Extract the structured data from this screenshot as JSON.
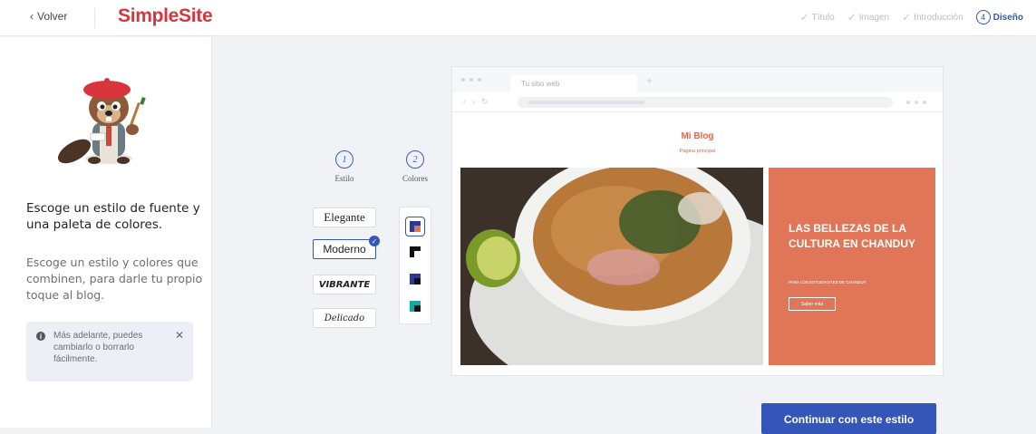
{
  "header": {
    "back_label": "Volver",
    "logo": "SimpleSite",
    "steps": [
      {
        "label": "Título",
        "state": "done"
      },
      {
        "label": "Imagen",
        "state": "done"
      },
      {
        "label": "Introducción",
        "state": "done"
      },
      {
        "label": "Diseño",
        "state": "active",
        "number": "4"
      }
    ]
  },
  "left": {
    "mascot_icon": "beaver-painter-icon",
    "heading": "Escoge un estilo de fuente y una paleta de colores.",
    "description": "Escoge un estilo y colores que combinen, para darle tu propio toque al blog.",
    "note": "Más adelante, puedes cambiarlo o borrarlo fácilmente."
  },
  "options": {
    "style_step": "1",
    "style_label": "Estilo",
    "colors_step": "2",
    "colors_label": "Colores",
    "fonts": [
      {
        "label": "Elegante",
        "selected": false
      },
      {
        "label": "Moderno",
        "selected": true
      },
      {
        "label": "VIBRANTE",
        "selected": false
      },
      {
        "label": "Delicado",
        "selected": false
      }
    ],
    "palettes": [
      {
        "a": "#2f3a8f",
        "b": "#e07657",
        "selected": true
      },
      {
        "a": "#111111",
        "b": "#ffffff",
        "selected": false
      },
      {
        "a": "#2f3a8f",
        "b": "#111111",
        "selected": false
      },
      {
        "a": "#1fa5a0",
        "b": "#111111",
        "selected": false
      }
    ]
  },
  "preview": {
    "tab_title": "Tu sitio web",
    "blog_title": "Mi Blog",
    "blog_subtitle": "Página principal",
    "hero_heading": "LAS BELLEZAS DE LA CULTURA EN CHANDUY",
    "hero_sub": "PARA LOS ESTUDIANTES DE CHANDUY",
    "hero_button": "Saber más",
    "hero_color": "#e07657"
  },
  "continue_label": "Continuar con este estilo",
  "colors": {
    "brand": "#d8343c",
    "primary": "#3456b9"
  }
}
